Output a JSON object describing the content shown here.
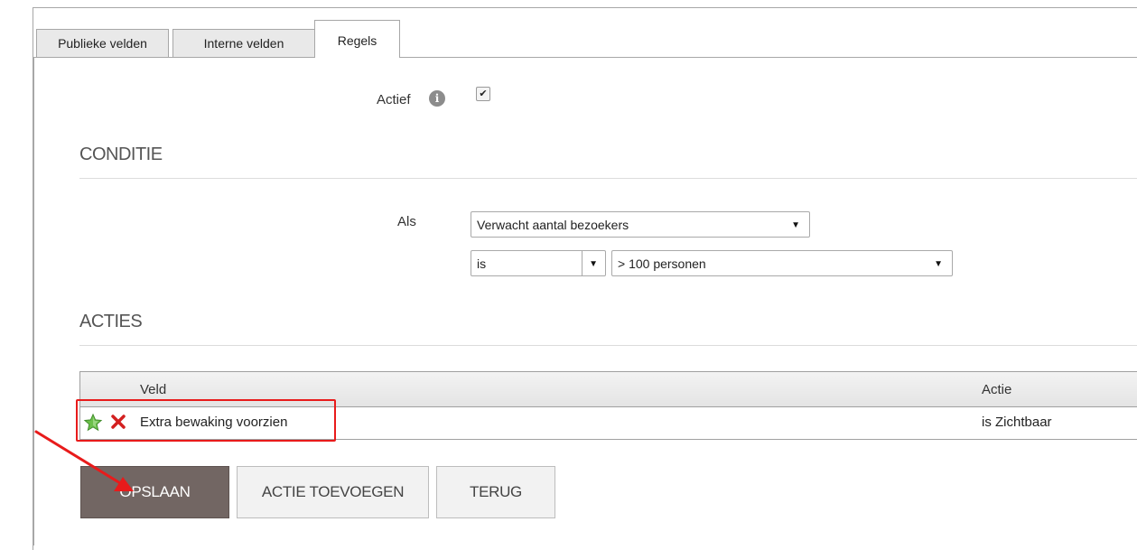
{
  "tabs": [
    {
      "label": "Publieke velden",
      "active": false
    },
    {
      "label": "Interne velden",
      "active": false
    },
    {
      "label": "Regels",
      "active": true
    }
  ],
  "actief": {
    "label": "Actief",
    "checked": true,
    "info_icon": "info-icon"
  },
  "conditie": {
    "title": "CONDITIE",
    "als_label": "Als",
    "field_select": "Verwacht aantal bezoekers",
    "operator_select": "is",
    "value_select": "> 100 personen"
  },
  "acties": {
    "title": "ACTIES",
    "columns": {
      "veld": "Veld",
      "actie": "Actie"
    },
    "rows": [
      {
        "veld": "Extra bewaking voorzien",
        "actie": "is Zichtbaar",
        "icons": [
          "star-icon",
          "delete-icon"
        ]
      }
    ]
  },
  "buttons": {
    "save": "OPSLAAN",
    "add_action": "ACTIE TOEVOEGEN",
    "back": "TERUG"
  },
  "colors": {
    "primary_button": "#726663",
    "annotation": "#e81b1b",
    "star": "#6cc04a",
    "delete": "#d32020"
  }
}
